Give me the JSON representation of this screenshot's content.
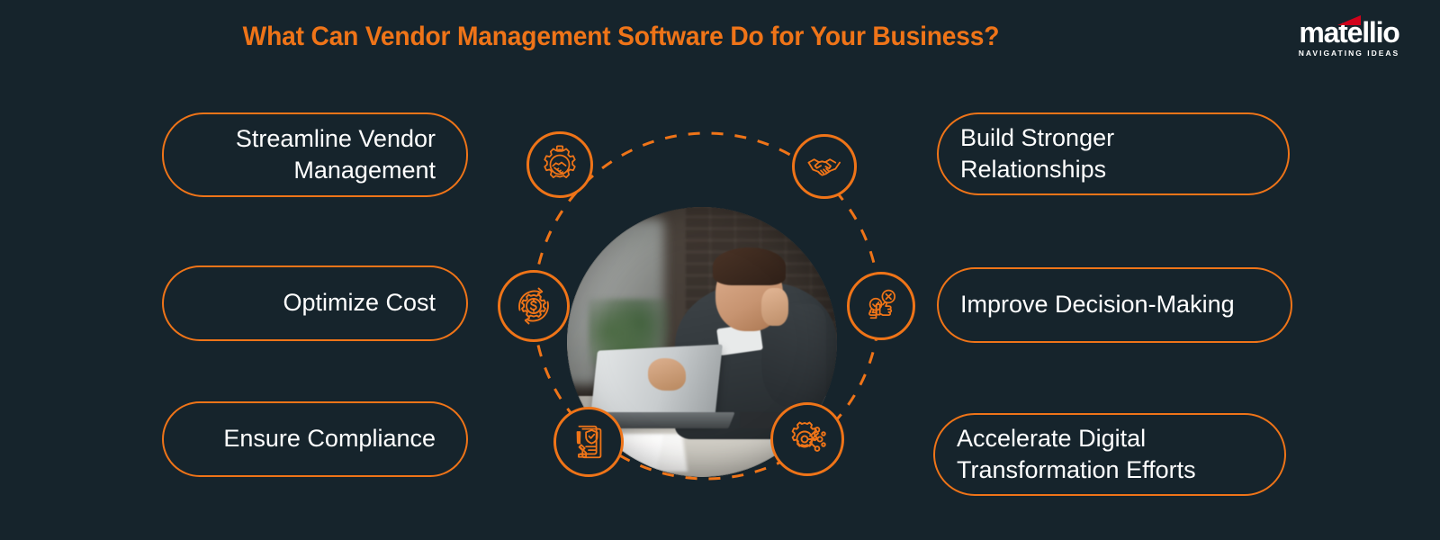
{
  "header": {
    "title": "What Can Vendor Management Software Do for Your Business?",
    "title_color": "#ef7418"
  },
  "logo": {
    "wordmark": "matellio",
    "tagline": "NAVIGATING IDEAS",
    "accent_color": "#d0021b",
    "text_color": "#ffffff"
  },
  "theme": {
    "background": "#16242c",
    "accent": "#ef7418",
    "text": "#ffffff"
  },
  "benefits": {
    "left": [
      {
        "label": "Streamline Vendor Management",
        "icon": "gear-handshake-icon"
      },
      {
        "label": "Optimize Cost",
        "icon": "dollar-gear-refresh-icon"
      },
      {
        "label": "Ensure Compliance",
        "icon": "document-shield-gavel-icon"
      }
    ],
    "right": [
      {
        "label": "Build Stronger Relationships",
        "icon": "handshake-icon"
      },
      {
        "label": "Improve Decision-Making",
        "icon": "hands-check-cross-icon"
      },
      {
        "label": "Accelerate Digital Transformation Efforts",
        "icon": "gear-network-icon"
      }
    ]
  },
  "center": {
    "photo_alt": "Businessman smiling on phone call at laptop in office",
    "ring_style": "dashed",
    "ring_color": "#ef7418"
  }
}
